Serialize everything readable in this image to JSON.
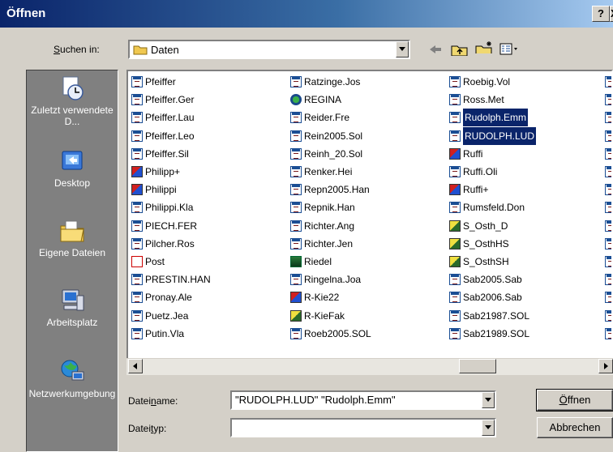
{
  "window": {
    "title": "Öffnen",
    "help_button": "?",
    "close_button": "X"
  },
  "lookin": {
    "label_pre": "",
    "label_accel": "S",
    "label_post": "uchen in:",
    "value": "Daten"
  },
  "toolbar": {
    "back": "back-arrow-icon",
    "up": "folder-up-icon",
    "newfolder": "new-folder-icon",
    "view": "view-menu-icon"
  },
  "places": [
    {
      "label": "Zuletzt verwendete D...",
      "icon": "recent-documents-icon"
    },
    {
      "label": "Desktop",
      "icon": "desktop-icon"
    },
    {
      "label": "Eigene Dateien",
      "icon": "my-documents-icon"
    },
    {
      "label": "Arbeitsplatz",
      "icon": "my-computer-icon"
    },
    {
      "label": "Netzwerkumgebung",
      "icon": "network-places-icon"
    }
  ],
  "files": {
    "col1": [
      {
        "name": "Pfeiffer",
        "icon": "text"
      },
      {
        "name": "Pfeiffer.Ger",
        "icon": "text"
      },
      {
        "name": "Pfeiffer.Lau",
        "icon": "text"
      },
      {
        "name": "Pfeiffer.Leo",
        "icon": "text"
      },
      {
        "name": "Pfeiffer.Sil",
        "icon": "text"
      },
      {
        "name": "Philipp+",
        "icon": "app"
      },
      {
        "name": "Philippi",
        "icon": "app"
      },
      {
        "name": "Philippi.Kla",
        "icon": "text"
      },
      {
        "name": "PIECH.FER",
        "icon": "text"
      },
      {
        "name": "Pilcher.Ros",
        "icon": "text"
      },
      {
        "name": "Post",
        "icon": "pdf"
      },
      {
        "name": "PRESTIN.HAN",
        "icon": "text"
      },
      {
        "name": "Pronay.Ale",
        "icon": "text"
      },
      {
        "name": "Puetz.Jea",
        "icon": "text"
      },
      {
        "name": "Putin.Vla",
        "icon": "text"
      }
    ],
    "col2": [
      {
        "name": "Ratzinge.Jos",
        "icon": "text"
      },
      {
        "name": "REGINA",
        "icon": "web"
      },
      {
        "name": "Reider.Fre",
        "icon": "text"
      },
      {
        "name": "Rein2005.Sol",
        "icon": "text"
      },
      {
        "name": "Reinh_20.Sol",
        "icon": "text"
      },
      {
        "name": "Renker.Hei",
        "icon": "text"
      },
      {
        "name": "Repn2005.Han",
        "icon": "text"
      },
      {
        "name": "Repnik.Han",
        "icon": "text"
      },
      {
        "name": "Richter.Ang",
        "icon": "text"
      },
      {
        "name": "Richter.Jen",
        "icon": "text"
      },
      {
        "name": "Riedel",
        "icon": "db"
      },
      {
        "name": "Ringelna.Joa",
        "icon": "text"
      },
      {
        "name": "R-Kie22",
        "icon": "app"
      },
      {
        "name": "R-KieFak",
        "icon": "img"
      },
      {
        "name": "Roeb2005.SOL",
        "icon": "text"
      }
    ],
    "col3": [
      {
        "name": "Roebig.Vol",
        "icon": "text"
      },
      {
        "name": "Ross.Met",
        "icon": "text"
      },
      {
        "name": "Rudolph.Emm",
        "icon": "text",
        "selected": true
      },
      {
        "name": "RUDOLPH.LUD",
        "icon": "text",
        "selected": true
      },
      {
        "name": "Ruffi",
        "icon": "app"
      },
      {
        "name": "Ruffi.Oli",
        "icon": "text"
      },
      {
        "name": "Ruffi+",
        "icon": "app"
      },
      {
        "name": "Rumsfeld.Don",
        "icon": "text"
      },
      {
        "name": "S_Osth_D",
        "icon": "img"
      },
      {
        "name": "S_OsthHS",
        "icon": "img"
      },
      {
        "name": "S_OsthSH",
        "icon": "img"
      },
      {
        "name": "Sab2005.Sab",
        "icon": "text"
      },
      {
        "name": "Sab2006.Sab",
        "icon": "text"
      },
      {
        "name": "Sab21987.SOL",
        "icon": "text"
      },
      {
        "name": "Sab21989.SOL",
        "icon": "text"
      }
    ]
  },
  "filename": {
    "label_pre": "Datei",
    "label_accel": "n",
    "label_post": "ame:",
    "value": "\"RUDOLPH.LUD\" \"Rudolph.Emm\""
  },
  "filetype": {
    "label_pre": "Datei",
    "label_accel": "t",
    "label_post": "yp:",
    "value": ""
  },
  "buttons": {
    "open_pre": "",
    "open_accel": "Ö",
    "open_post": "ffnen",
    "cancel": "Abbrechen"
  }
}
